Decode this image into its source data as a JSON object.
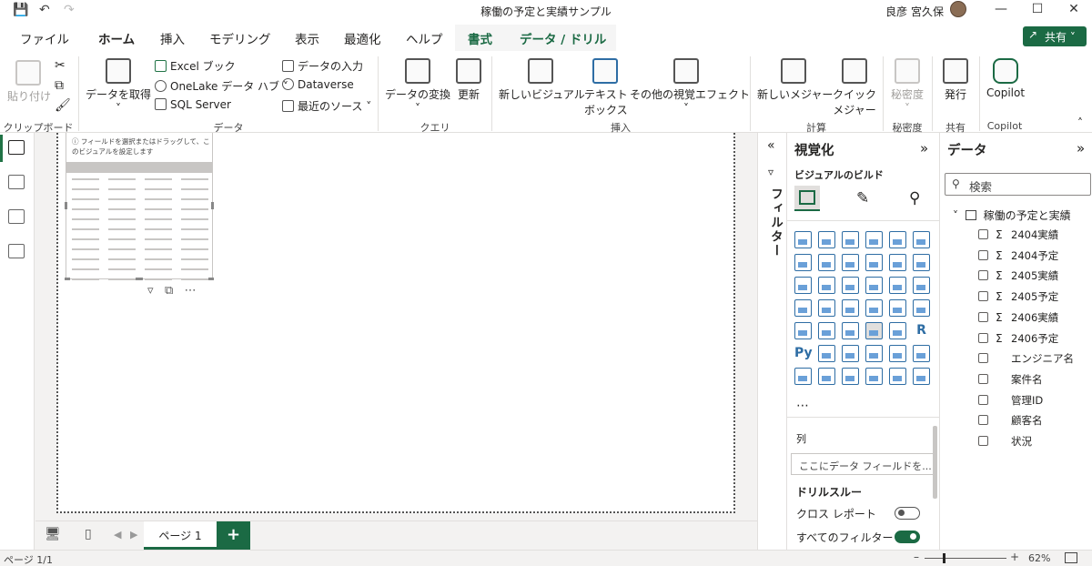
{
  "window": {
    "title": "稼働の予定と実績サンプル",
    "user_name": "良彦 宮久保"
  },
  "tabs": [
    {
      "label": "ファイル",
      "active": false
    },
    {
      "label": "ホーム",
      "active": true
    },
    {
      "label": "挿入",
      "active": false
    },
    {
      "label": "モデリング",
      "active": false
    },
    {
      "label": "表示",
      "active": false
    },
    {
      "label": "最適化",
      "active": false
    },
    {
      "label": "ヘルプ",
      "active": false
    },
    {
      "label": "書式",
      "active": false
    },
    {
      "label": "データ / ドリル",
      "active": false
    }
  ],
  "share_label": "共有",
  "ribbon": {
    "clipboard": {
      "paste": "貼り付け",
      "group": "クリップボード"
    },
    "data": {
      "get_data": "データを取得",
      "excel": "Excel ブック",
      "onelake": "OneLake データ ハブ",
      "sql": "SQL Server",
      "enter_data": "データの入力",
      "dataverse": "Dataverse",
      "recent": "最近のソース",
      "group": "データ"
    },
    "query": {
      "transform": "データの変換",
      "refresh": "更新",
      "group": "クエリ"
    },
    "insert": {
      "new_visual": "新しいビジュアル",
      "textbox_1": "テキスト",
      "textbox_2": "ボックス",
      "more_visuals": "その他の視覚エフェクト",
      "group": "挿入"
    },
    "calc": {
      "new_measure": "新しいメジャー",
      "quick_measure_1": "クイック",
      "quick_measure_2": "メジャー",
      "group": "計算"
    },
    "sensitivity": {
      "label": "秘密度",
      "group": "秘密度"
    },
    "share": {
      "publish": "発行",
      "group": "共有"
    },
    "copilot": {
      "label": "Copilot",
      "group": "Copilot"
    }
  },
  "canvas": {
    "visual_hint": "フィールドを選択またはドラッグして、このビジュアルを設定します"
  },
  "filter_pane": {
    "label": "フィルター"
  },
  "viz_pane": {
    "title": "視覚化",
    "build_label": "ビジュアルのビルド",
    "columns_label": "列",
    "columns_placeholder": "ここにデータ フィールドを...",
    "drillthrough_label": "ドリルスルー",
    "cross_report_label": "クロス レポート",
    "cross_report_on": false,
    "keep_all_filters_label": "すべてのフィルター",
    "keep_all_filters_on": true,
    "r_label": "R",
    "py_label": "Py"
  },
  "data_pane": {
    "title": "データ",
    "search_placeholder": "検索",
    "table_name": "稼働の予定と実績",
    "fields": [
      {
        "name": "2404実績",
        "numeric": true
      },
      {
        "name": "2404予定",
        "numeric": true
      },
      {
        "name": "2405実績",
        "numeric": true
      },
      {
        "name": "2405予定",
        "numeric": true
      },
      {
        "name": "2406実績",
        "numeric": true
      },
      {
        "name": "2406予定",
        "numeric": true
      },
      {
        "name": "エンジニア名",
        "numeric": false
      },
      {
        "name": "案件名",
        "numeric": false
      },
      {
        "name": "管理ID",
        "numeric": false
      },
      {
        "name": "顧客名",
        "numeric": false
      },
      {
        "name": "状況",
        "numeric": false
      }
    ]
  },
  "pages": [
    {
      "label": "ページ 1",
      "active": true
    }
  ],
  "status": {
    "page_indicator": "ページ 1/1",
    "zoom": "62%"
  }
}
